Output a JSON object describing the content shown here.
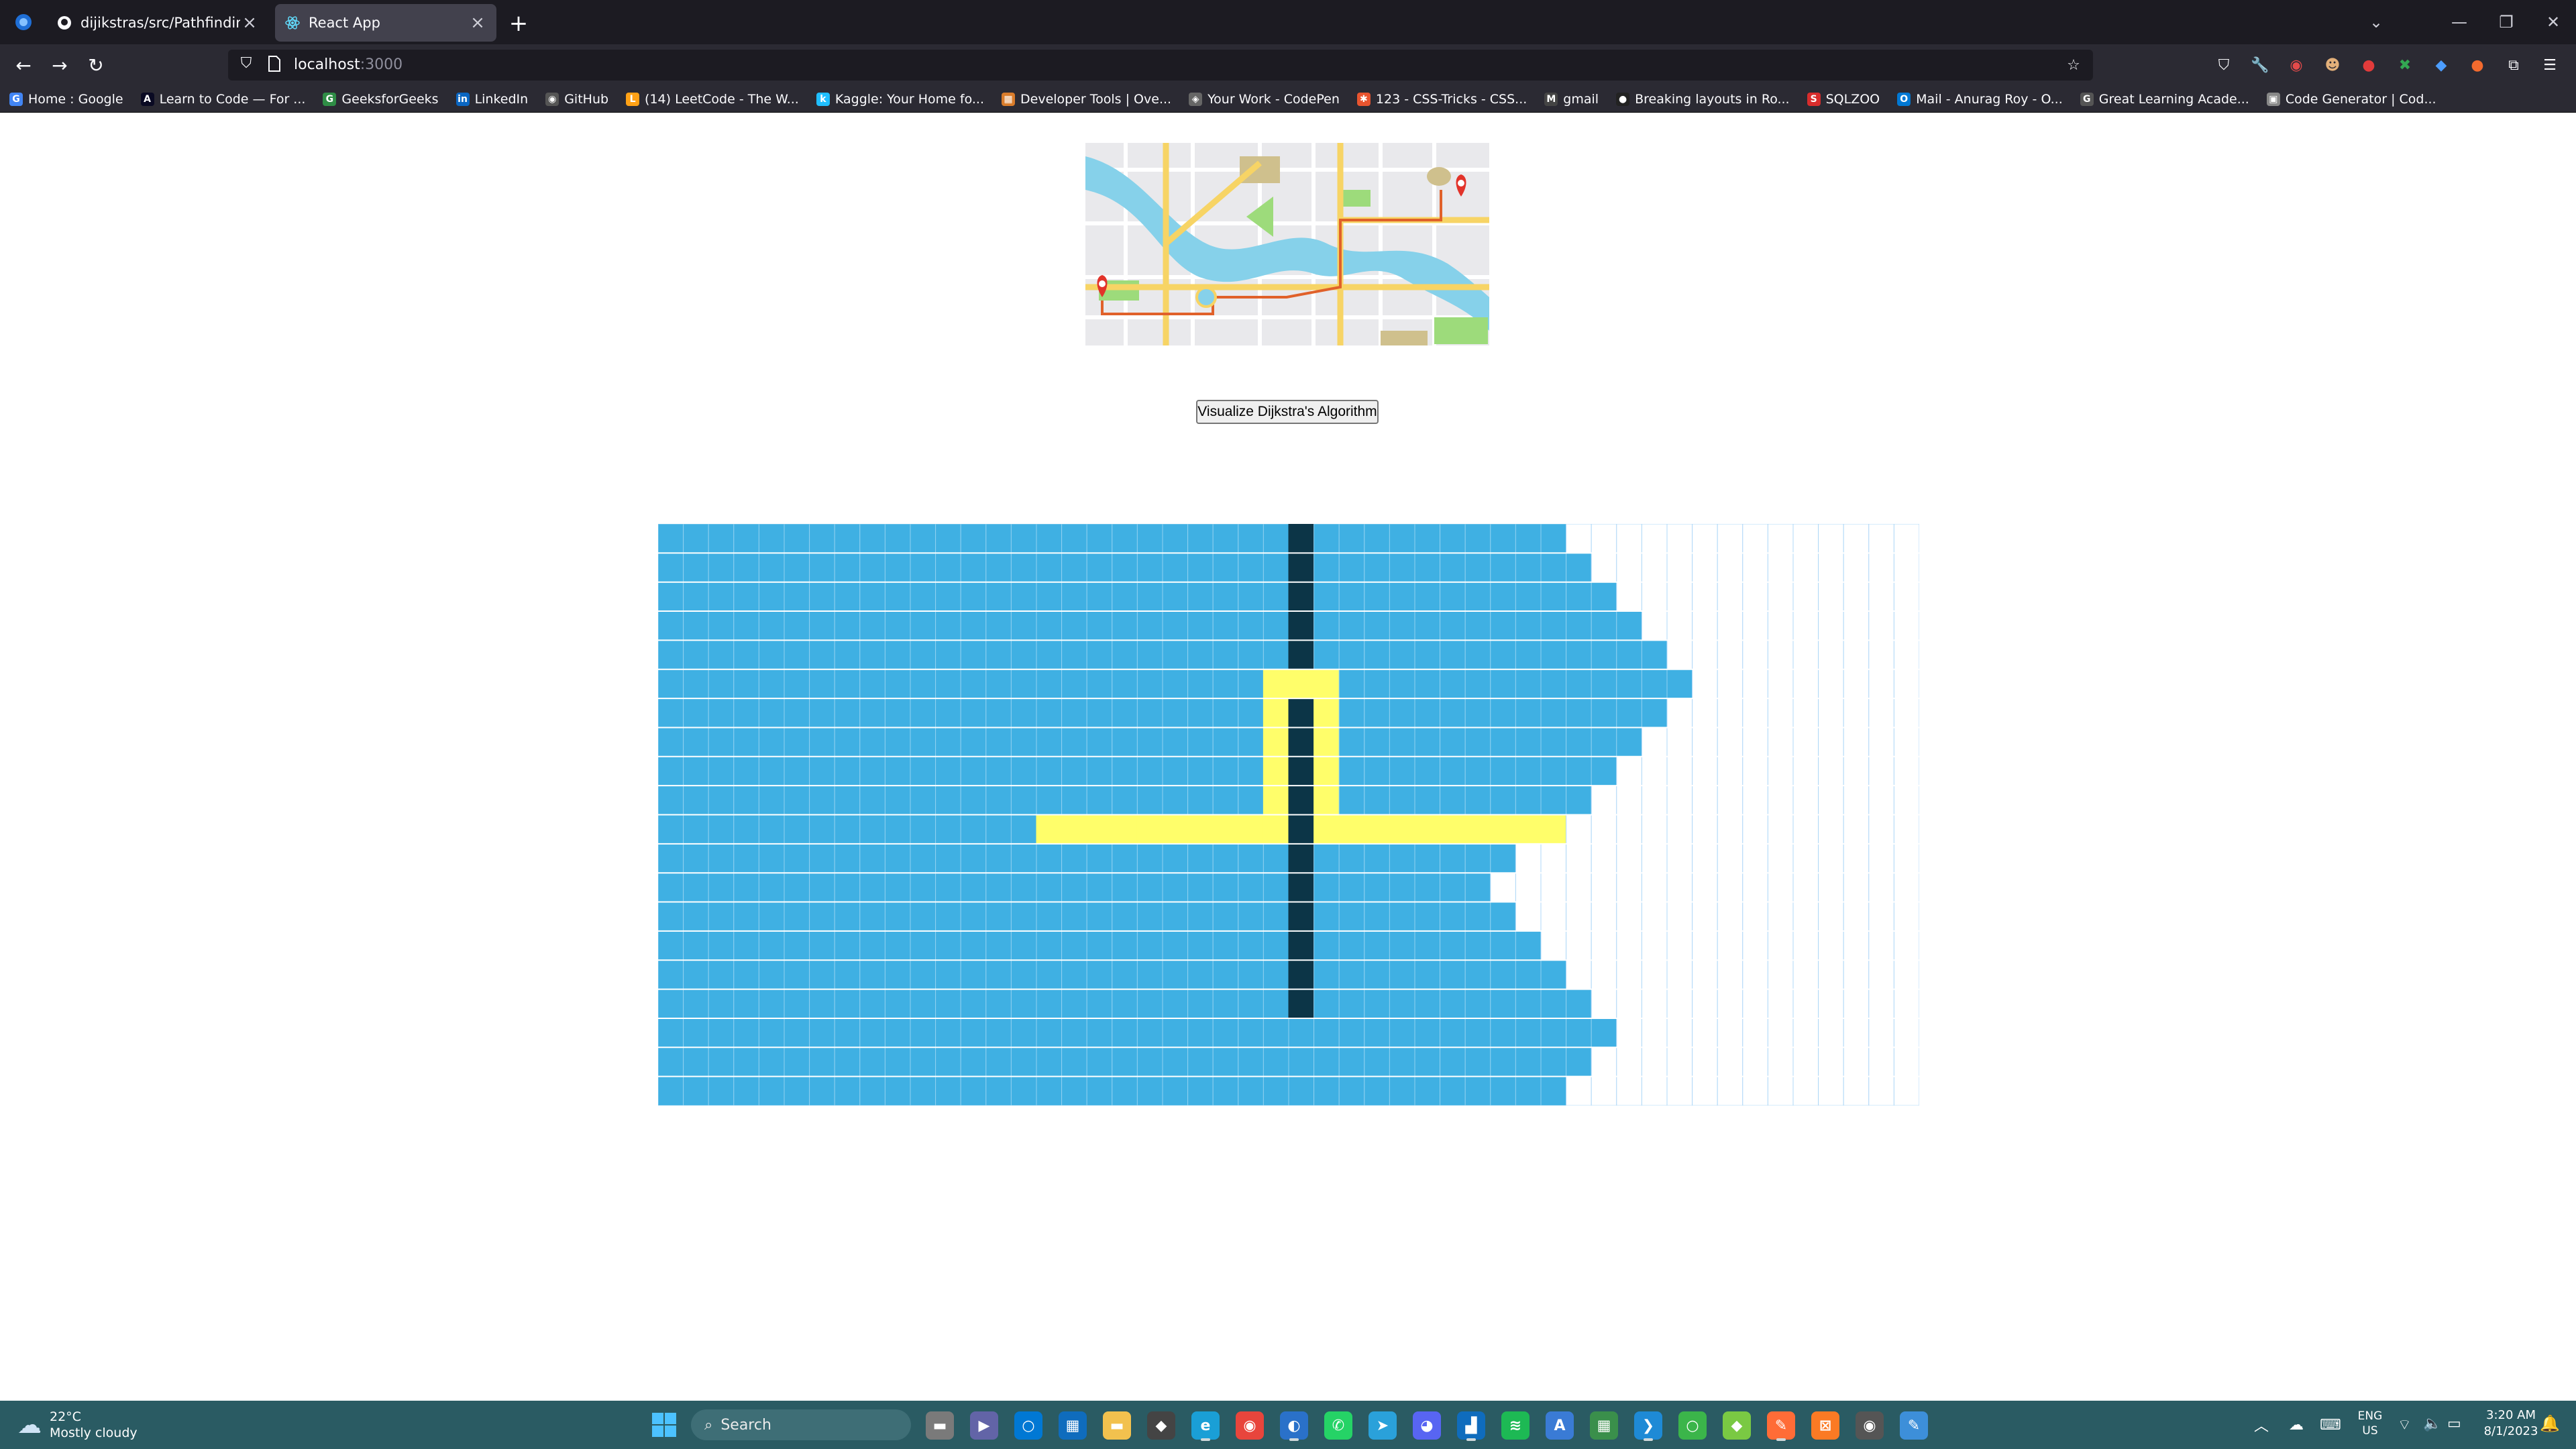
{
  "browser": {
    "tabs": [
      {
        "label": "dijikstras/src/PathfindingVisuali",
        "active": false,
        "icon": "github-icon"
      },
      {
        "label": "React App",
        "active": true,
        "icon": "react-icon"
      }
    ],
    "new_tab_label": "+",
    "url": {
      "host": "localhost",
      "port": ":3000"
    },
    "bookmarks": [
      {
        "label": "Home : Google",
        "icon": "G",
        "color": "#4285f4"
      },
      {
        "label": "Learn to Code — For ...",
        "icon": "A",
        "color": "#0a0a23"
      },
      {
        "label": "GeeksforGeeks",
        "icon": "G",
        "color": "#2f8d46"
      },
      {
        "label": "LinkedIn",
        "icon": "in",
        "color": "#0a66c2"
      },
      {
        "label": "GitHub",
        "icon": "◉",
        "color": "#555555"
      },
      {
        "label": "(14) LeetCode - The W...",
        "icon": "L",
        "color": "#ffa116"
      },
      {
        "label": "Kaggle: Your Home fo...",
        "icon": "k",
        "color": "#20beff"
      },
      {
        "label": "Developer Tools | Ove...",
        "icon": "▦",
        "color": "#d97c2b"
      },
      {
        "label": "Your Work - CodePen",
        "icon": "◈",
        "color": "#666666"
      },
      {
        "label": "123 - CSS-Tricks - CSS...",
        "icon": "✱",
        "color": "#e8542f"
      },
      {
        "label": "gmail",
        "icon": "M",
        "color": "#444444"
      },
      {
        "label": "Breaking layouts in Ro...",
        "icon": "●",
        "color": "#222222"
      },
      {
        "label": "SQLZOO",
        "icon": "S",
        "color": "#d82c2c"
      },
      {
        "label": "Mail - Anurag Roy - O...",
        "icon": "O",
        "color": "#0078d4"
      },
      {
        "label": "Great Learning Acade...",
        "icon": "G",
        "color": "#555555"
      },
      {
        "label": "Code Generator | Cod...",
        "icon": "▣",
        "color": "#888888"
      }
    ]
  },
  "page": {
    "visualize_button": "Visualize Dijkstra's Algorithm",
    "grid": {
      "rows": 20,
      "cols": 50,
      "visited_count_per_row": [
        36,
        37,
        38,
        39,
        40,
        41,
        40,
        39,
        38,
        37,
        36,
        34,
        33,
        34,
        35,
        36,
        37,
        38,
        37,
        36
      ],
      "wall_col": 25,
      "wall_rows": [
        0,
        1,
        2,
        3,
        4,
        6,
        7,
        8,
        9,
        10,
        11,
        12,
        13,
        14,
        15,
        16
      ],
      "path_cells": [
        [
          5,
          24
        ],
        [
          5,
          25
        ],
        [
          5,
          26
        ],
        [
          6,
          24
        ],
        [
          6,
          26
        ],
        [
          7,
          24
        ],
        [
          7,
          26
        ],
        [
          8,
          24
        ],
        [
          8,
          26
        ],
        [
          9,
          24
        ],
        [
          9,
          26
        ],
        [
          10,
          15
        ],
        [
          10,
          16
        ],
        [
          10,
          17
        ],
        [
          10,
          18
        ],
        [
          10,
          19
        ],
        [
          10,
          20
        ],
        [
          10,
          21
        ],
        [
          10,
          22
        ],
        [
          10,
          23
        ],
        [
          10,
          24
        ],
        [
          10,
          26
        ],
        [
          10,
          27
        ],
        [
          10,
          28
        ],
        [
          10,
          29
        ],
        [
          10,
          30
        ],
        [
          10,
          31
        ],
        [
          10,
          32
        ],
        [
          10,
          33
        ],
        [
          10,
          34
        ],
        [
          10,
          35
        ]
      ],
      "colors": {
        "visited": "#3fb0e3",
        "wall": "#0c3547",
        "path": "#fffe6a",
        "empty": "#ffffff",
        "border": "#afd8f8"
      }
    }
  },
  "taskbar": {
    "weather": {
      "temp": "22°C",
      "condition": "Mostly cloudy"
    },
    "search_placeholder": "Search",
    "language": {
      "lang": "ENG",
      "region": "US"
    },
    "clock": {
      "time": "3:20 AM",
      "date": "8/1/2023"
    },
    "apps": [
      {
        "name": "file-explorer-icon",
        "color": "#7a7a7a",
        "glyph": "▬"
      },
      {
        "name": "teams-icon",
        "color": "#6264a7",
        "glyph": "▶"
      },
      {
        "name": "cortana-icon",
        "color": "#0078d4",
        "glyph": "○"
      },
      {
        "name": "store-icon",
        "color": "#0f6cbd",
        "glyph": "▦"
      },
      {
        "name": "folder-icon",
        "color": "#f2c14e",
        "glyph": "▬"
      },
      {
        "name": "app-icon",
        "color": "#444444",
        "glyph": "◆"
      },
      {
        "name": "edge-icon",
        "color": "#1a9fd6",
        "glyph": "e"
      },
      {
        "name": "chrome-icon",
        "color": "#e8453c",
        "glyph": "◉"
      },
      {
        "name": "firefox-icon",
        "color": "#2a71c9",
        "glyph": "◐"
      },
      {
        "name": "whatsapp-icon",
        "color": "#25d366",
        "glyph": "✆"
      },
      {
        "name": "telegram-icon",
        "color": "#2aa1da",
        "glyph": "➤"
      },
      {
        "name": "discord-icon",
        "color": "#5865f2",
        "glyph": "◕"
      },
      {
        "name": "blue-app-icon",
        "color": "#0f6cbd",
        "glyph": "▟"
      },
      {
        "name": "spotify-icon",
        "color": "#1db954",
        "glyph": "≋"
      },
      {
        "name": "app-store-icon",
        "color": "#3a7bd5",
        "glyph": "A"
      },
      {
        "name": "sheets-icon",
        "color": "#3a8f4b",
        "glyph": "▦"
      },
      {
        "name": "vscode-icon",
        "color": "#1e8ad6",
        "glyph": "❯"
      },
      {
        "name": "green-ring-icon",
        "color": "#3bb54a",
        "glyph": "○"
      },
      {
        "name": "git-icon",
        "color": "#7ac943",
        "glyph": "◆"
      },
      {
        "name": "postman-icon",
        "color": "#ff6c37",
        "glyph": "✎"
      },
      {
        "name": "xampp-icon",
        "color": "#fb7a24",
        "glyph": "⊠"
      },
      {
        "name": "github-desktop-icon",
        "color": "#555555",
        "glyph": "◉"
      },
      {
        "name": "blue-tool-icon",
        "color": "#3d8fd9",
        "glyph": "✎"
      }
    ]
  }
}
